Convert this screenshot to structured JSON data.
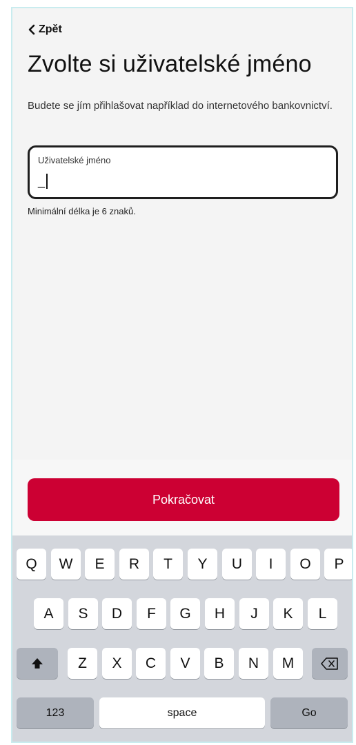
{
  "header": {
    "back_label": "Zpět"
  },
  "page": {
    "title": "Zvolte si uživatelské jméno",
    "subtitle": "Budete se jím přihlašovat například do internetového bankovnictví."
  },
  "username_field": {
    "label": "Uživatelské jméno",
    "value": "_"
  },
  "hint": "Minimální délka je 6 znaků.",
  "continue_button": {
    "label": "Pokračovat",
    "color": "#cc0033"
  },
  "keyboard": {
    "row1": [
      "Q",
      "W",
      "E",
      "R",
      "T",
      "Y",
      "U",
      "I",
      "O",
      "P"
    ],
    "row2": [
      "A",
      "S",
      "D",
      "F",
      "G",
      "H",
      "J",
      "K",
      "L"
    ],
    "row3": [
      "Z",
      "X",
      "C",
      "V",
      "B",
      "N",
      "M"
    ],
    "shift_icon": "shift-arrow-icon",
    "backspace_icon": "backspace-icon",
    "numbers_label": "123",
    "space_label": "space",
    "go_label": "Go"
  }
}
